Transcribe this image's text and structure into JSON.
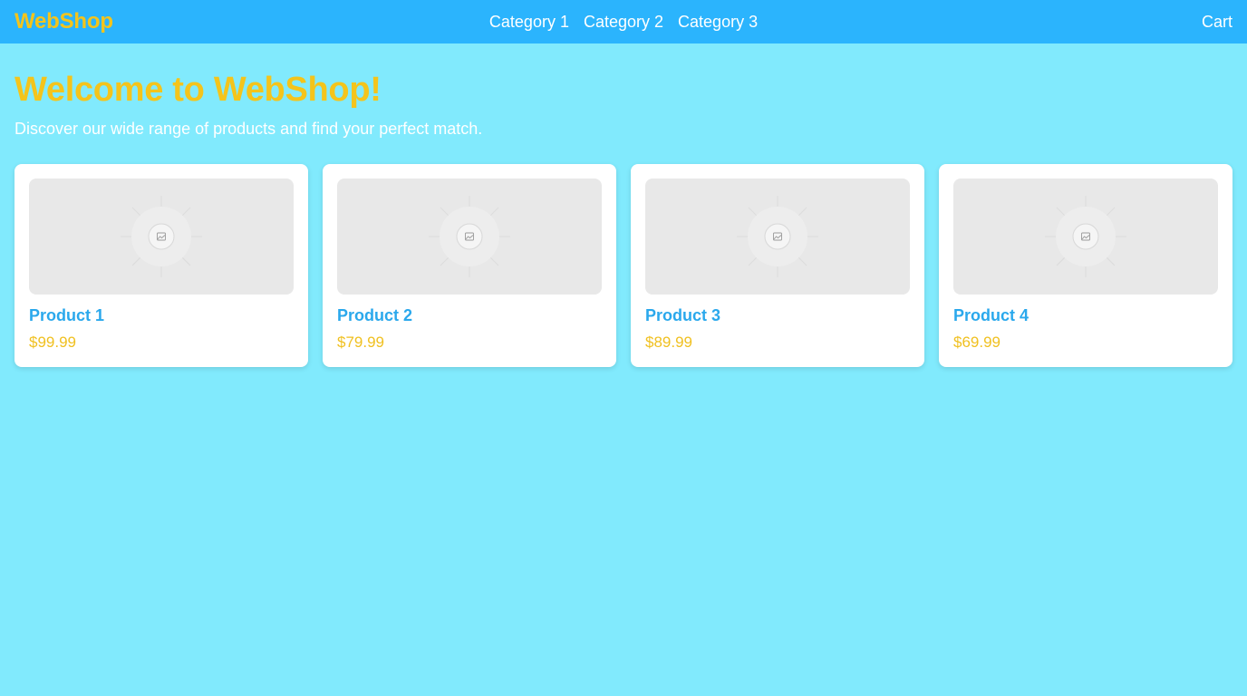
{
  "header": {
    "brand": "WebShop",
    "nav": [
      {
        "label": "Category 1"
      },
      {
        "label": "Category 2"
      },
      {
        "label": "Category 3"
      }
    ],
    "cart_label": "Cart"
  },
  "hero": {
    "title": "Welcome to WebShop!",
    "subtitle": "Discover our wide range of products and find your perfect match."
  },
  "products": [
    {
      "name": "Product 1",
      "price": "$99.99",
      "image_icon": "image-placeholder-icon"
    },
    {
      "name": "Product 2",
      "price": "$79.99",
      "image_icon": "image-placeholder-icon"
    },
    {
      "name": "Product 3",
      "price": "$89.99",
      "image_icon": "image-placeholder-icon"
    },
    {
      "name": "Product 4",
      "price": "$69.99",
      "image_icon": "image-placeholder-icon"
    }
  ],
  "colors": {
    "background": "#81eafd",
    "navbar": "#2bb4fd",
    "brand_accent": "#f4c41b",
    "product_name": "#2aa8ec",
    "price": "#f0c020"
  }
}
